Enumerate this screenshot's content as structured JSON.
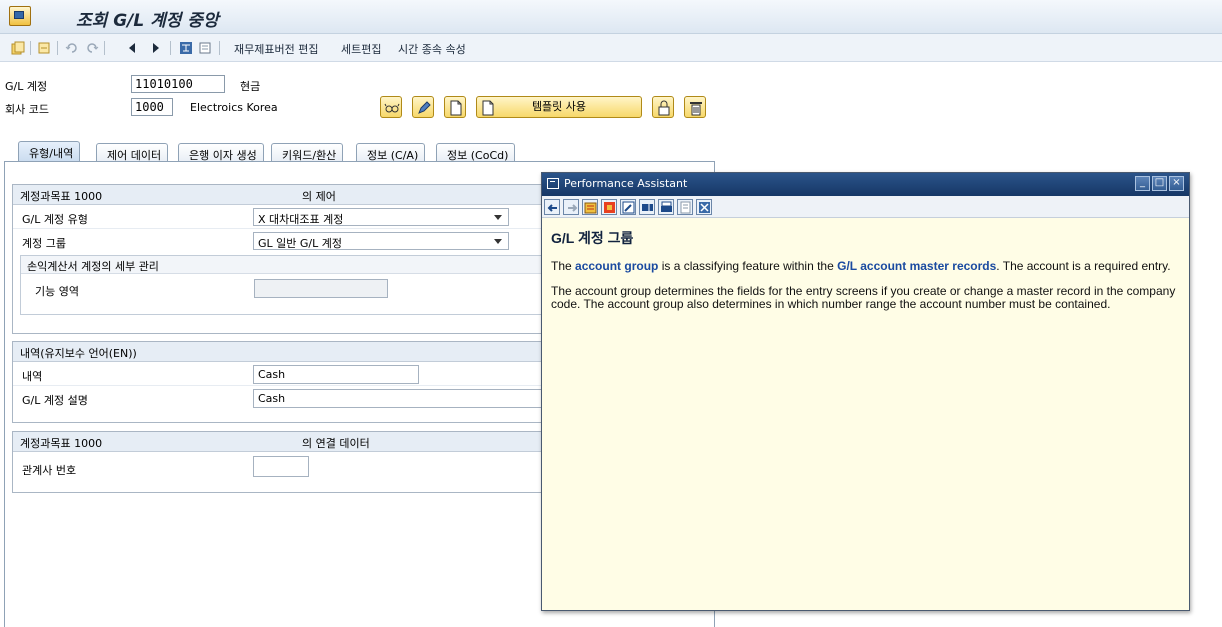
{
  "title": "조회 G/L 계정 중앙",
  "toolbar": {
    "items": [
      "재무제표버전 편집",
      "세트편집",
      "시간 종속 속성"
    ]
  },
  "header": {
    "gl_account_label": "G/L 계정",
    "gl_account_value": "11010100",
    "gl_account_text": "현금",
    "company_code_label": "회사 코드",
    "company_code_value": "1000",
    "company_code_text": "Electroics Korea",
    "template_button": "템플릿 사용"
  },
  "tabs": [
    {
      "label": "유형/내역",
      "active": true
    },
    {
      "label": "제어 데이터",
      "active": false
    },
    {
      "label": "은행 이자 생성",
      "active": false
    },
    {
      "label": "키워드/환산",
      "active": false
    },
    {
      "label": "정보 (C/A)",
      "active": false
    },
    {
      "label": "정보 (CoCd)",
      "active": false
    }
  ],
  "group1": {
    "title": "계정과목표 1000",
    "title_suffix": "의 제어",
    "account_type_label": "G/L 계정 유형",
    "account_type_value": "X 대차대조표 계정",
    "account_group_label": "계정 그룹",
    "account_group_value": "GL 일반 G/L 계정",
    "pl_sub_title": "손익계산서 계정의 세부 관리",
    "functional_area_label": "기능 영역",
    "functional_area_value": ""
  },
  "group2": {
    "title": "내역(유지보수 언어(EN))",
    "short_text_label": "내역",
    "short_text_value": "Cash",
    "long_text_label": "G/L 계정 설명",
    "long_text_value": "Cash"
  },
  "group3": {
    "title": "계정과목표 1000",
    "title_suffix": "의 연결 데이터",
    "trading_partner_label": "관계사 번호",
    "trading_partner_value": ""
  },
  "assistant": {
    "window_title": "Performance Assistant",
    "heading": "G/L 계정 그룹",
    "p1_before": "The ",
    "p1_link1": "account group",
    "p1_mid": " is a classifying feature within the ",
    "p1_link2": "G/L account master records",
    "p1_after": ". The account is a required entry.",
    "p2": "The account group determines the fields for the entry screens if you create or change a master record in the company code. The account group also determines in which number range the account number must be contained."
  },
  "colors": {
    "titlebar_bg": "#e4ecf5",
    "button_yellow": "#f7d86a",
    "assistant_header": "#163766",
    "assistant_body": "#fffde6",
    "link": "#1a4aa0"
  }
}
